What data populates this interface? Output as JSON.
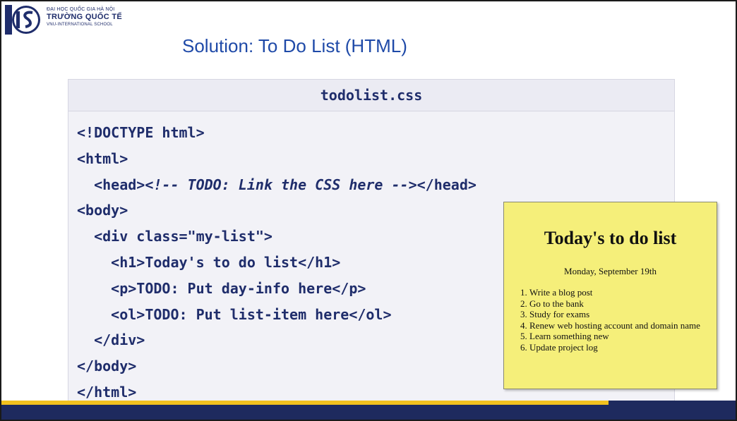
{
  "header": {
    "school_line1": "ĐẠI HỌC QUỐC GIA HÀ NỘI",
    "school_line2": "TRƯỜNG QUỐC TẾ",
    "school_line3": "VNU-INTERNATIONAL SCHOOL",
    "logo_icon": "is-logo-icon"
  },
  "title": "Solution: To Do List (HTML)",
  "code": {
    "filename": "todolist.css",
    "lines": [
      "<!DOCTYPE html>",
      "<html>",
      "  <head>",
      "<!-- TODO: Link the CSS here -->",
      "</head>",
      "<body>",
      "  <div class=\"my-list\">",
      "    <h1>Today's to do list</h1>",
      "    <p>TODO: Put day-info here</p>",
      "    <ol>TODO: Put list-item here</ol>",
      "  </div>",
      "</body>",
      "</html>"
    ]
  },
  "preview": {
    "heading": "Today's to do list",
    "day": "Monday, September 19th",
    "items": [
      "Write a blog post",
      "Go to the bank",
      "Study for exams",
      "Renew web hosting account and domain name",
      "Learn something new",
      "Update project log"
    ]
  },
  "colors": {
    "title": "#1f4aa8",
    "code_text": "#1f2d6b",
    "panel_bg": "#f2f2f7",
    "preview_bg": "#f5ef7a",
    "footer": "#1e2a5e",
    "footer_accent": "#f2c11f"
  }
}
